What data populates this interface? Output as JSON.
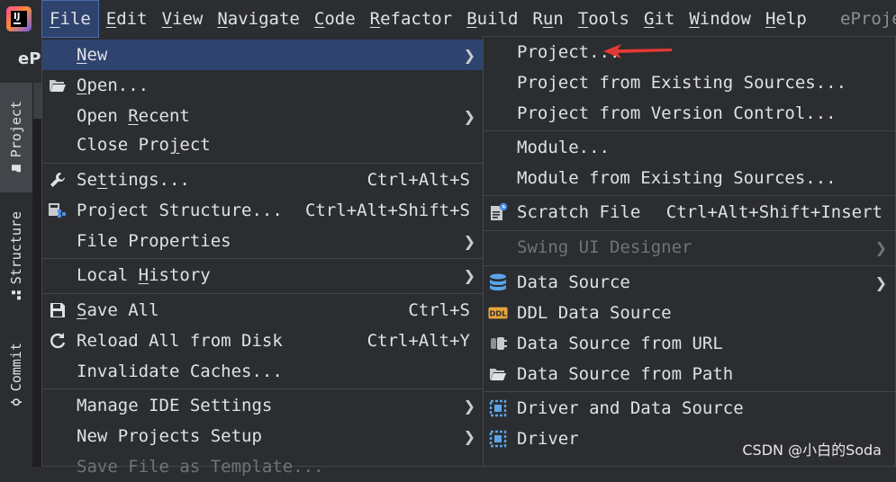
{
  "menubar": {
    "items": [
      {
        "label": "File",
        "mn": "F",
        "rest": "ile",
        "active": true
      },
      {
        "label": "Edit",
        "mn": "E",
        "rest": "dit"
      },
      {
        "label": "View",
        "mn": "V",
        "rest": "iew"
      },
      {
        "label": "Navigate",
        "mn": "N",
        "rest": "avigate"
      },
      {
        "label": "Code",
        "mn": "C",
        "rest": "ode"
      },
      {
        "label": "Refactor",
        "mn": "R",
        "rest": "efactor"
      },
      {
        "label": "Build",
        "mn": "B",
        "rest": "uild"
      },
      {
        "label": "Run",
        "pre": "R",
        "mn": "u",
        "rest": "n"
      },
      {
        "label": "Tools",
        "mn": "T",
        "rest": "ools"
      },
      {
        "label": "Git",
        "mn": "G",
        "rest": "it"
      },
      {
        "label": "Window",
        "mn": "W",
        "rest": "indow"
      },
      {
        "label": "Help",
        "mn": "H",
        "rest": "elp"
      }
    ],
    "window_title": "eProje"
  },
  "project_name": "eP",
  "tool_stripe": {
    "project": "Project",
    "structure": "Structure",
    "commit": "Commit"
  },
  "file_menu": {
    "new": {
      "pre": "",
      "mn": "N",
      "post": "ew"
    },
    "open": {
      "pre": "",
      "mn": "O",
      "post": "pen..."
    },
    "open_recent": {
      "pre": "Open ",
      "mn": "R",
      "post": "ecent"
    },
    "close_project": {
      "pre": "Close Pro",
      "mn": "j",
      "post": "ect"
    },
    "settings": {
      "pre": "Se",
      "mn": "t",
      "post": "tings...",
      "shortcut": "Ctrl+Alt+S"
    },
    "project_structure": {
      "label": "Project Structure...",
      "shortcut": "Ctrl+Alt+Shift+S"
    },
    "file_properties": {
      "label": "File Properties"
    },
    "local_history": {
      "pre": "Local ",
      "mn": "H",
      "post": "istory"
    },
    "save_all": {
      "pre": "",
      "mn": "S",
      "post": "ave All",
      "shortcut": "Ctrl+S"
    },
    "reload_all": {
      "label": "Reload All from Disk",
      "shortcut": "Ctrl+Alt+Y"
    },
    "invalidate_caches": {
      "label": "Invalidate Caches..."
    },
    "manage_ide_settings": {
      "label": "Manage IDE Settings"
    },
    "new_projects_setup": {
      "label": "New Projects Setup"
    },
    "save_file_as_template": {
      "label": "Save File as Template..."
    }
  },
  "new_submenu": {
    "project": "Project...",
    "project_existing": "Project from Existing Sources...",
    "project_vcs": "Project from Version Control...",
    "module": "Module...",
    "module_existing": "Module from Existing Sources...",
    "scratch_file": {
      "label": "Scratch File",
      "shortcut": "Ctrl+Alt+Shift+Insert"
    },
    "swing_ui_designer": "Swing UI Designer",
    "data_source": "Data Source",
    "ddl_data_source": "DDL Data Source",
    "data_source_url": "Data Source from URL",
    "data_source_path": "Data Source from Path",
    "driver_and_data_source": "Driver and Data Source",
    "driver": "Driver"
  },
  "watermark": "CSDN @小白的Soda",
  "colors": {
    "background": "#2b2d30",
    "highlight": "#2e436e",
    "border": "#43454a",
    "text": "#dfe1e5",
    "disabled": "#6f737a",
    "annotation_arrow": "#e53935"
  }
}
